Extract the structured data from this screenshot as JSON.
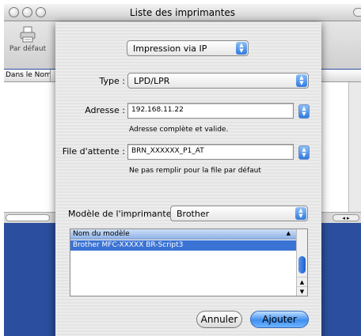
{
  "window": {
    "title": "Liste des imprimantes"
  },
  "toolbar": {
    "default_label": "Par défaut"
  },
  "list": {
    "column_header": "Dans le  Nom"
  },
  "dialog": {
    "connection_popup": "Impression via IP",
    "type_label": "Type :",
    "type_value": "LPD/LPR",
    "address_label": "Adresse :",
    "address_value": "192.168.11.22",
    "address_hint": "Adresse complète et valide.",
    "queue_label": "File d'attente :",
    "queue_value": "BRN_XXXXXX_P1_AT",
    "queue_hint": "Ne pas remplir pour la file par défaut",
    "model_label": "Modèle de l'imprimante :",
    "model_value": "Brother",
    "model_table": {
      "header": "Nom du modèle",
      "rows": [
        "Brother MFC-XXXXX BR-Script3"
      ]
    },
    "cancel_label": "Annuler",
    "add_label": "Ajouter"
  },
  "colors": {
    "accent": "#3b73d4",
    "desktop": "#2b4f9e"
  }
}
